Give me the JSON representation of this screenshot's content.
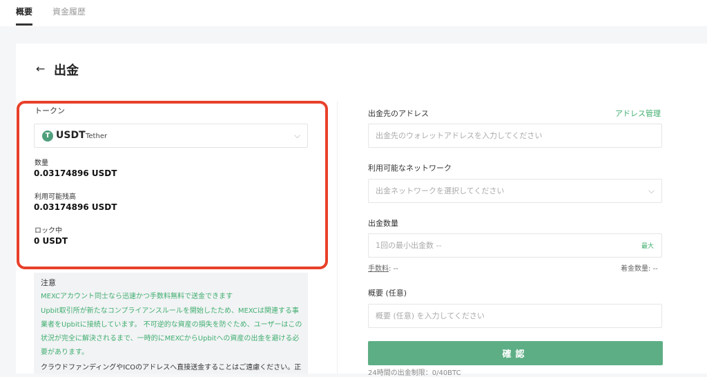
{
  "tabs": [
    {
      "label": "概要",
      "active": true
    },
    {
      "label": "資金履歴",
      "active": false
    }
  ],
  "page": {
    "title": "出金",
    "back_icon": "arrow-left-icon"
  },
  "token": {
    "label": "トークン",
    "symbol": "USDT",
    "name": "Tether",
    "icon_letter": "T",
    "icon_color": "#4f9f7d"
  },
  "balances": [
    {
      "label": "数量",
      "value": "0.03174896 USDT"
    },
    {
      "label": "利用可能残高",
      "value": "0.03174896 USDT"
    },
    {
      "label": "ロック中",
      "value": "0 USDT"
    }
  ],
  "notice": {
    "title": "注意",
    "lines": [
      "MEXCアカウント同士なら迅速かつ手数料無料で送金できます",
      "Upbit取引所が新たなコンプライアンスルールを開始したため、MEXCは関連する事",
      "業者をUpbitに接続しています。 不可逆的な資産の損失を防ぐため、ユーザーはこの",
      "状況が完全に解決されるまで、一時的にMEXCからUpbitへの資産の出金を避ける必",
      "要があります。"
    ],
    "dark_line": "クラウドファンディングやICOのアドレスへ直接送金することはご遠慮ください。正"
  },
  "address": {
    "label": "出金先のアドレス",
    "manage_link": "アドレス管理",
    "placeholder": "出金先のウォレットアドレスを入力してください"
  },
  "network": {
    "label": "利用可能なネットワーク",
    "placeholder": "出金ネットワークを選択してください"
  },
  "amount": {
    "label": "出金数量",
    "placeholder": "1回の最小出金数 --",
    "max_label": "最大",
    "fee_label": "手数料",
    "fee_value": ": --",
    "received_label": "着金数量",
    "received_value": ": --"
  },
  "memo": {
    "label": "概要 (任意)",
    "placeholder": "概要 (任意) を入力してください"
  },
  "confirm_label": "確認",
  "limit_text": "24時間の出金制限：0/40BTC",
  "colors": {
    "accent": "#5dae85",
    "highlight": "#e8402a",
    "notice_text": "#3fae6f"
  }
}
